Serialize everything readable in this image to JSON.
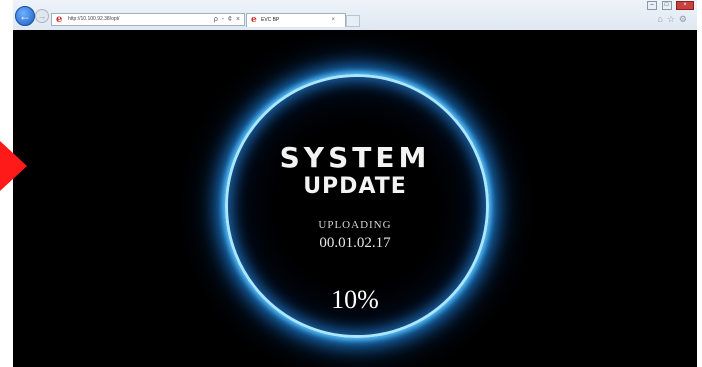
{
  "browser": {
    "address_url": "http://10.100.92.38/opt/",
    "address_actions": "ρ - ¢ ×",
    "tab_title": "EVC BP",
    "tab_close": "×",
    "nav_back_icon": "arrow-left",
    "nav_forward_icon": "arrow-right"
  },
  "update": {
    "title": "SYSTEM",
    "subtitle": "UPDATE",
    "status_label": "UPLOADING",
    "version": "00.01.02.17",
    "progress_percent": "10%"
  },
  "colors": {
    "halo": "#5fc8ff",
    "annotation_arrow": "#ff1a1a",
    "background": "#000000"
  }
}
